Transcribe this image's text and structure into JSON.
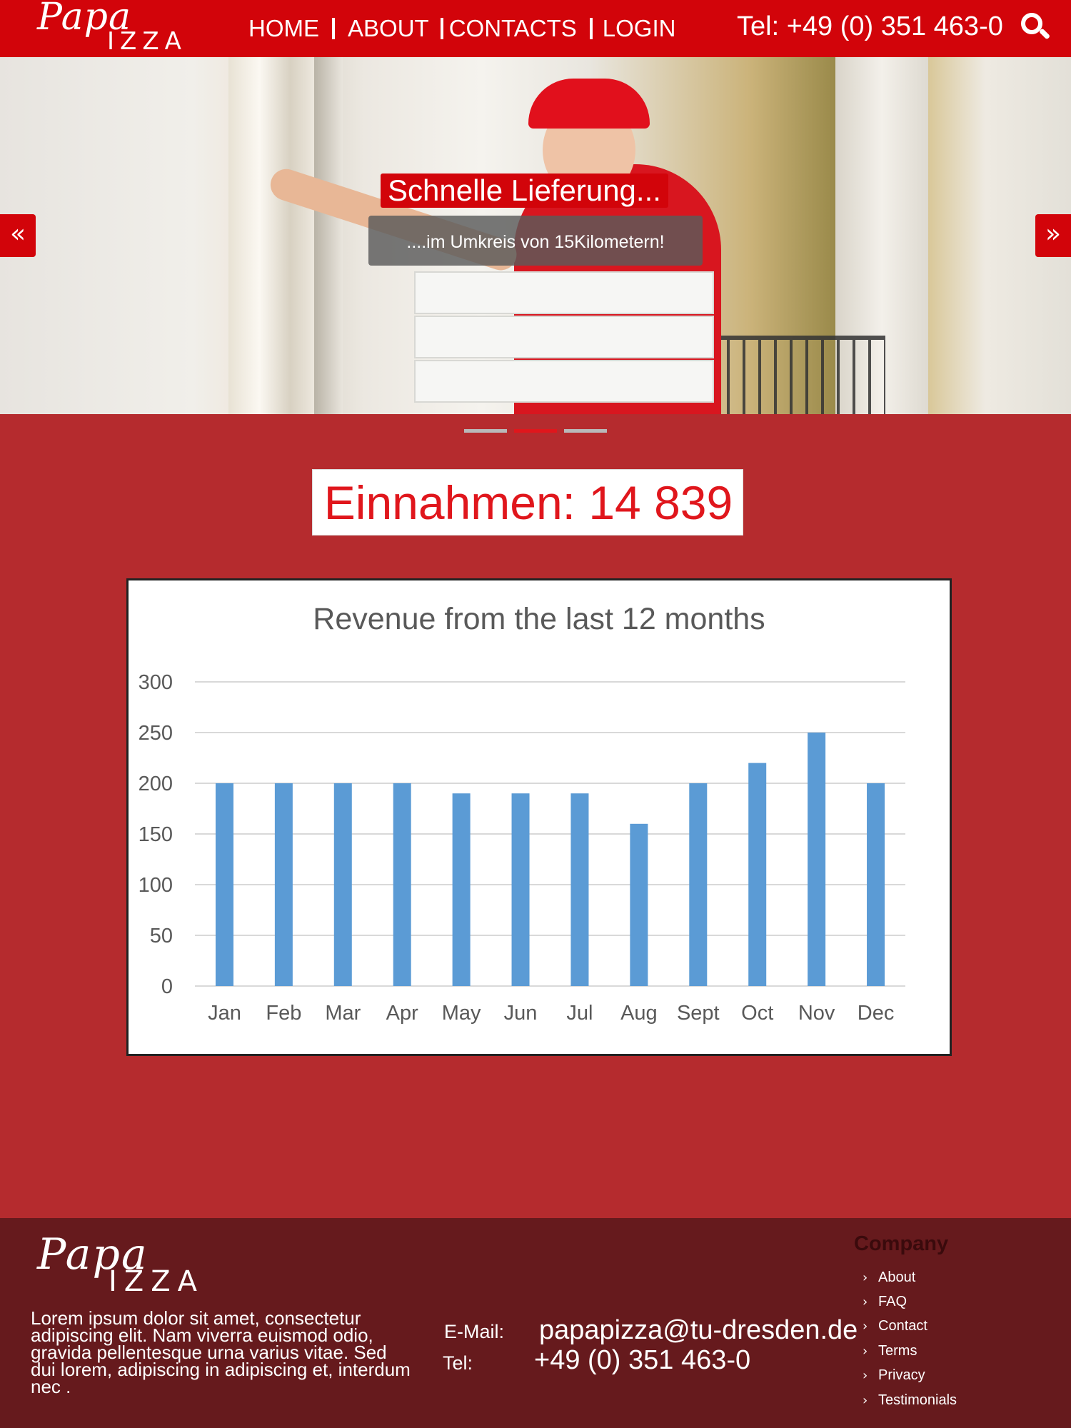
{
  "header": {
    "logo_top": "Papa",
    "logo_bottom": "IZZA",
    "nav": [
      "HOME",
      "ABOUT",
      "CONTACTS",
      "LOGIN"
    ],
    "phone": "Tel: +49 (0) 351 463-0",
    "search_icon": "search-icon"
  },
  "hero": {
    "title": "Schnelle Lieferung...",
    "subtitle": "....im Umkreis von  15Kilometern!",
    "prev_icon": "«",
    "next_icon": "»",
    "slides": 3,
    "active_slide": 2
  },
  "revenue": {
    "label": "Einnahmen: 14 839"
  },
  "chart_data": {
    "type": "bar",
    "title": "Revenue from the last 12 months",
    "categories": [
      "Jan",
      "Feb",
      "Mar",
      "Apr",
      "May",
      "Jun",
      "Jul",
      "Aug",
      "Sept",
      "Oct",
      "Nov",
      "Dec"
    ],
    "values": [
      200,
      200,
      200,
      200,
      190,
      190,
      190,
      160,
      200,
      220,
      250,
      200
    ],
    "ylim": [
      0,
      300
    ],
    "yticks": [
      0,
      50,
      100,
      150,
      200,
      250,
      300
    ],
    "xlabel": "",
    "ylabel": "",
    "grid": true,
    "bar_color": "#5b9bd5"
  },
  "footer": {
    "logo_top": "Papa",
    "logo_bottom": "IZZA",
    "lorem": "Lorem ipsum dolor sit amet, consectetur adipiscing elit. Nam viverra euismod odio, gravida pellentesque urna varius vitae. Sed dui lorem, adipiscing in adipiscing et, interdum nec .",
    "email_label": "E-Mail:",
    "email": "papapizza@tu-dresden.de",
    "tel_label": "Tel:",
    "tel": "+49 (0) 351 463-0",
    "company_title": "Company",
    "company_links": [
      "About",
      "FAQ",
      "Contact",
      "Terms",
      "Privacy",
      "Testimonials"
    ]
  },
  "colors": {
    "header_red": "#d2040a",
    "body_red": "#b52b2e",
    "footer_dark": "#661a1d",
    "accent_red": "#e0161c"
  }
}
